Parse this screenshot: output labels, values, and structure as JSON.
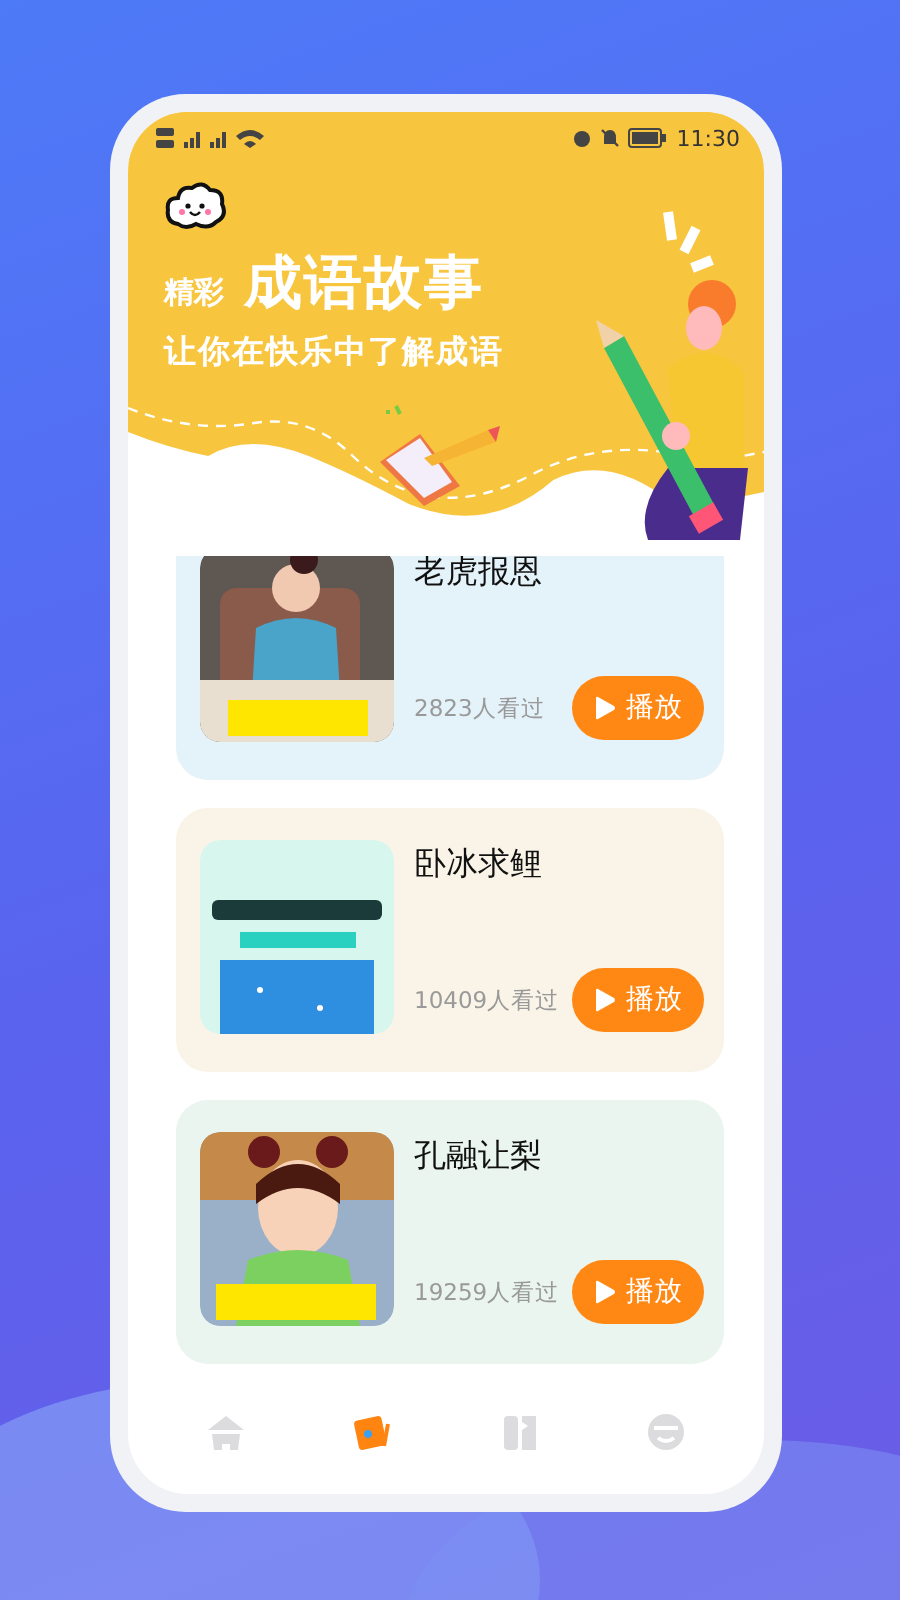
{
  "status_bar": {
    "time": "11:30"
  },
  "banner": {
    "prefix": "精彩",
    "title": "成语故事",
    "subtitle": "让你在快乐中了解成语"
  },
  "stories": [
    {
      "title": "老虎报恩",
      "views": "2823人看过",
      "action": "播放",
      "color": "#e4f2fa"
    },
    {
      "title": "卧冰求鲤",
      "views": "10409人看过",
      "action": "播放",
      "color": "#faf4e8"
    },
    {
      "title": "孔融让梨",
      "views": "19259人看过",
      "action": "播放",
      "color": "#e9f5ee"
    }
  ],
  "nav": [
    {
      "kind": "home",
      "selected": false
    },
    {
      "kind": "video",
      "selected": true
    },
    {
      "kind": "book",
      "selected": false
    },
    {
      "kind": "profile",
      "selected": false
    }
  ]
}
